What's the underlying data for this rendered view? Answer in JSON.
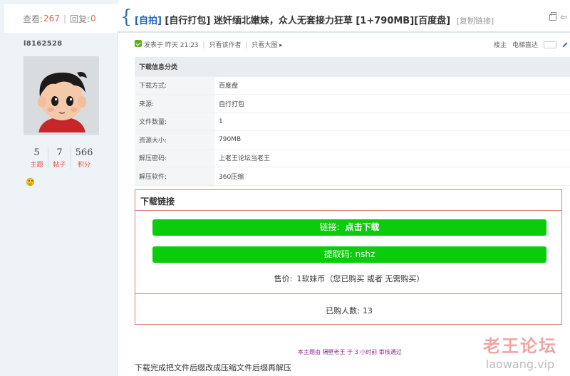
{
  "stats": {
    "views_label": "查看:",
    "views": "267",
    "separator": "|",
    "replies_label": "回复:",
    "replies": "0"
  },
  "thread": {
    "title_tags": "[自拍]",
    "title_text": "[自行打包] 迷奸缅北嫩妹，众人无套接力狂草 [1+790MB][百度盘]",
    "copy_link": "[复制链接]"
  },
  "author": {
    "username": "l8162528",
    "counts": [
      {
        "num": "5",
        "label": "主题"
      },
      {
        "num": "7",
        "label": "帖子"
      },
      {
        "num": "566",
        "label": "积分"
      }
    ]
  },
  "post_meta": {
    "posted": "发表于 昨天 21:23",
    "only_author": "只看该作者",
    "only_big_image": "只看大图",
    "arrow": "▸",
    "floor": "楼主",
    "direct": "电梯直达"
  },
  "info_table": {
    "heading": "下载信息分类",
    "rows": [
      {
        "key": "下载方式:",
        "value": "百度盘"
      },
      {
        "key": "来源:",
        "value": "自行打包"
      },
      {
        "key": "文件数量:",
        "value": "1"
      },
      {
        "key": "资源大小:",
        "value": "790MB"
      },
      {
        "key": "解压密码:",
        "value": "上老王论坛当老王"
      },
      {
        "key": "解压软件:",
        "value": "360压缩"
      }
    ]
  },
  "download": {
    "title": "下载链接",
    "link_label": "链接:",
    "link_text": "点击下载",
    "extract_code": "提取码: nshz",
    "price_label": "售价:",
    "price_value": "1软妹币（您已购买 或者 无需购买）",
    "buyers_label": "已购人数:",
    "buyers_value": "13"
  },
  "moderation_note": "本主题由 隔壁老王 于 3 小时前 审核通过",
  "footer_text": "下载完成把文件后缀改成压缩文件后缀再解压",
  "watermark": {
    "cn": "老王论坛",
    "url": "laowang.vip"
  }
}
